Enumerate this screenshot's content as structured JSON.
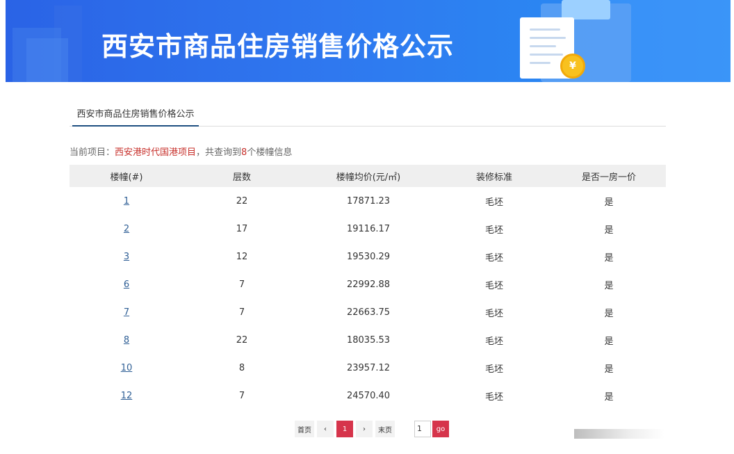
{
  "banner": {
    "title": "西安市商品住房销售价格公示",
    "coin_symbol": "¥"
  },
  "tab": {
    "label": "西安市商品住房销售价格公示"
  },
  "info": {
    "prefix": "当前项目：",
    "project": "西安港时代国港项目",
    "mid": "，共查询到",
    "count": "8",
    "suffix": "个楼幢信息"
  },
  "table": {
    "headers": [
      "楼幢(#)",
      "层数",
      "楼幢均价(元/㎡)",
      "装修标准",
      "是否一房一价"
    ],
    "rows": [
      [
        "1",
        "22",
        "17871.23",
        "毛坯",
        "是"
      ],
      [
        "2",
        "17",
        "19116.17",
        "毛坯",
        "是"
      ],
      [
        "3",
        "12",
        "19530.29",
        "毛坯",
        "是"
      ],
      [
        "6",
        "7",
        "22992.88",
        "毛坯",
        "是"
      ],
      [
        "7",
        "7",
        "22663.75",
        "毛坯",
        "是"
      ],
      [
        "8",
        "22",
        "18035.53",
        "毛坯",
        "是"
      ],
      [
        "10",
        "8",
        "23957.12",
        "毛坯",
        "是"
      ],
      [
        "12",
        "7",
        "24570.40",
        "毛坯",
        "是"
      ]
    ]
  },
  "pager": {
    "first": "首页",
    "prev": "‹",
    "current": "1",
    "next": "›",
    "last": "末页",
    "input_value": "1",
    "go": "go"
  },
  "colors": {
    "accent": "#d6344b",
    "link": "#2e5e95",
    "highlight": "#c7302b",
    "banner": "#2f78ef"
  }
}
